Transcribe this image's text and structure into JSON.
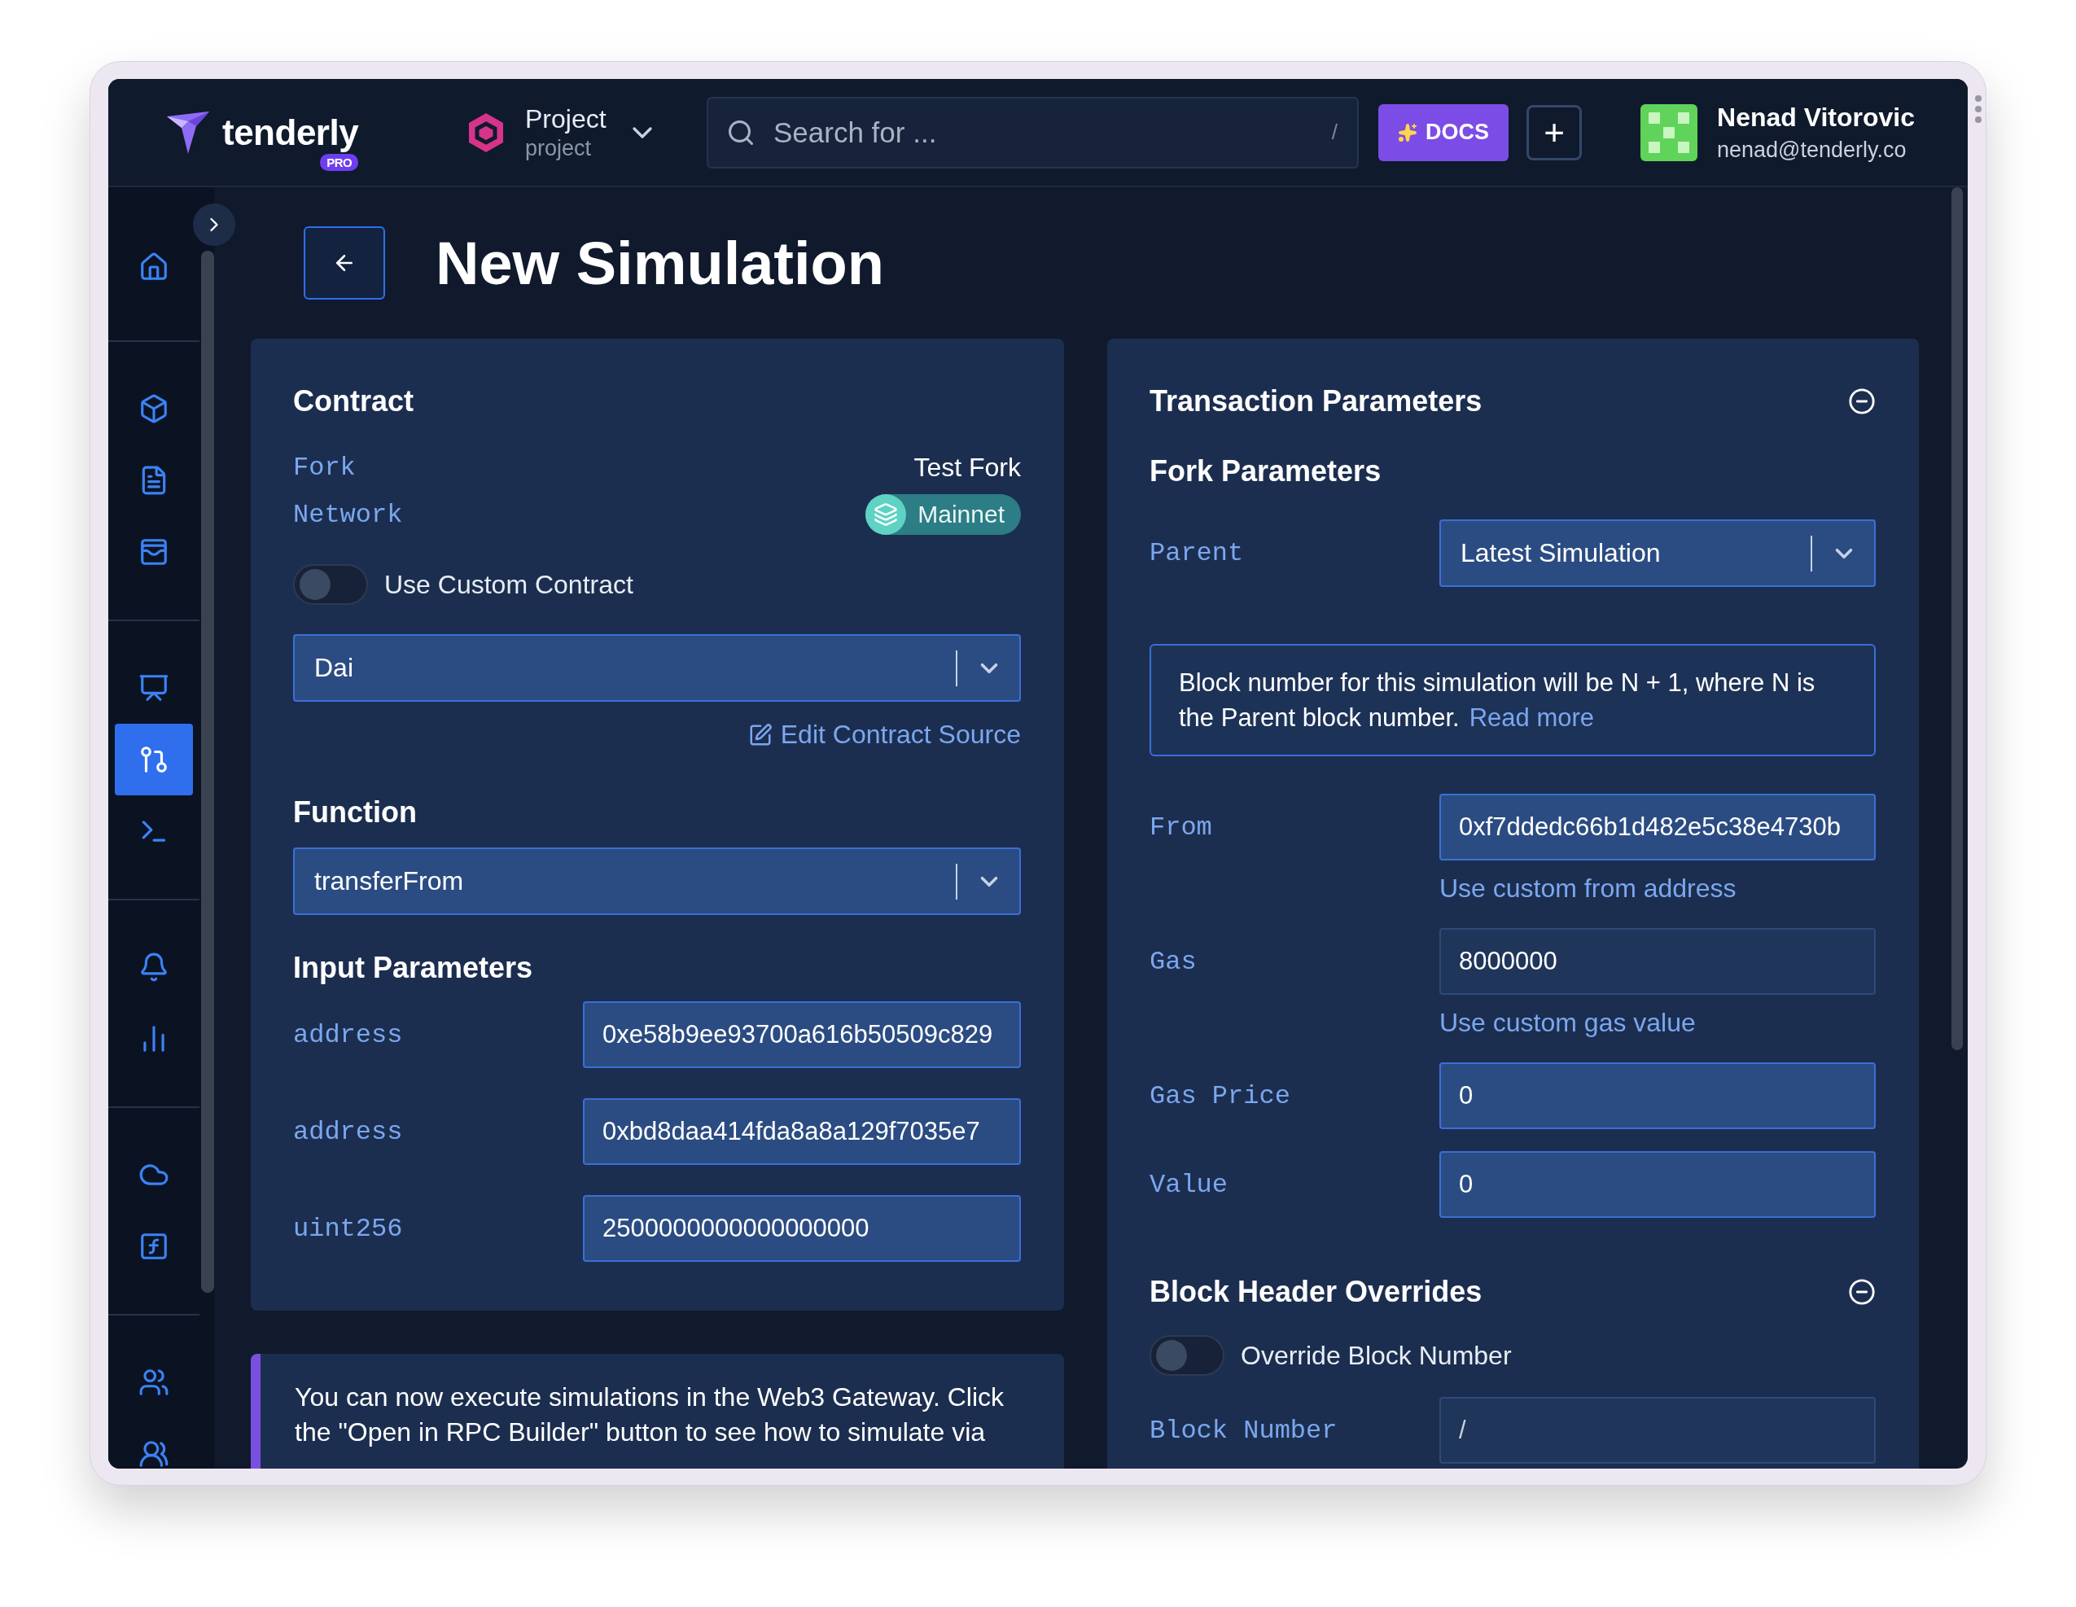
{
  "header": {
    "logo": {
      "name": "tenderly",
      "badge": "PRO"
    },
    "project": {
      "title": "Project",
      "subtitle": "project"
    },
    "search": {
      "placeholder": "Search for ...",
      "shortcut": "/"
    },
    "docs_button": "DOCS",
    "add_button": "+",
    "user": {
      "name": "Nenad Vitorovic",
      "email": "nenad@tenderly.co"
    }
  },
  "sidebar": {
    "groups": [
      [
        {
          "kind": "home",
          "selected": false
        }
      ],
      [
        {
          "kind": "cube",
          "selected": false
        },
        {
          "kind": "file",
          "selected": false
        },
        {
          "kind": "wallet",
          "selected": false
        }
      ],
      [
        {
          "kind": "presentation",
          "selected": false
        },
        {
          "kind": "pull-request",
          "selected": true
        },
        {
          "kind": "terminal",
          "selected": false
        }
      ],
      [
        {
          "kind": "bell",
          "selected": false
        },
        {
          "kind": "chart",
          "selected": false
        }
      ],
      [
        {
          "kind": "cloud",
          "selected": false
        },
        {
          "kind": "function",
          "selected": false
        }
      ],
      [
        {
          "kind": "users",
          "selected": false
        },
        {
          "kind": "team",
          "selected": false
        }
      ]
    ]
  },
  "page": {
    "title": "New Simulation"
  },
  "contract_card": {
    "title": "Contract",
    "fork": {
      "label": "Fork",
      "value": "Test Fork"
    },
    "network": {
      "label": "Network",
      "value": "Mainnet"
    },
    "custom_contract_toggle": {
      "label": "Use Custom Contract",
      "on": false
    },
    "contract_select": {
      "value": "Dai"
    },
    "edit_link": "Edit Contract Source",
    "function": {
      "title": "Function",
      "value": "transferFrom"
    },
    "input_parameters": {
      "title": "Input Parameters",
      "params": [
        {
          "type": "address",
          "value": "0xe58b9ee93700a616b50509c829"
        },
        {
          "type": "address",
          "value": "0xbd8daa414fda8a8a129f7035e7"
        },
        {
          "type": "uint256",
          "value": "2500000000000000000"
        }
      ]
    }
  },
  "banner": {
    "text": "You can now execute simulations in the Web3 Gateway. Click the \"Open in RPC Builder\" button to see how to simulate via"
  },
  "transaction_card": {
    "title": "Transaction Parameters",
    "fork_parameters": {
      "title": "Fork Parameters",
      "parent": {
        "label": "Parent",
        "value": "Latest Simulation"
      },
      "info": {
        "text": "Block number for this simulation will be N + 1, where N is the Parent block number.",
        "link": "Read more"
      }
    },
    "fields": [
      {
        "label": "From",
        "value": "0xf7ddedc66b1d482e5c38e4730b",
        "disabled": false,
        "hint": "Use custom from address"
      },
      {
        "label": "Gas",
        "value": "8000000",
        "disabled": true,
        "hint": "Use custom gas value"
      },
      {
        "label": "Gas Price",
        "value": "0",
        "disabled": false
      },
      {
        "label": "Value",
        "value": "0",
        "disabled": false
      }
    ],
    "block_overrides": {
      "title": "Block Header Overrides",
      "toggle": {
        "label": "Override Block Number",
        "on": false
      },
      "block_number": {
        "label": "Block Number",
        "placeholder": "/",
        "disabled": true
      }
    }
  }
}
